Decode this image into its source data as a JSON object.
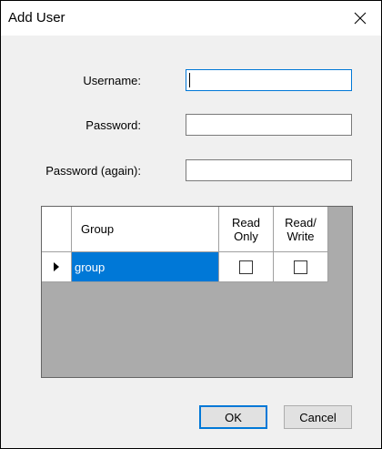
{
  "window": {
    "title": "Add User",
    "close_icon": "close-icon"
  },
  "form": {
    "username_label": "Username:",
    "username_value": "",
    "password_label": "Password:",
    "password_value": "",
    "password_again_label": "Password (again):",
    "password_again_value": ""
  },
  "grid": {
    "columns": [
      "",
      "Group",
      "Read Only",
      "Read/ Write"
    ],
    "rows": [
      {
        "group": "group",
        "read_only": false,
        "read_write": false,
        "selected": true
      }
    ]
  },
  "buttons": {
    "ok_label": "OK",
    "cancel_label": "Cancel"
  },
  "colors": {
    "selection": "#0078d7",
    "grid_background": "#ababab",
    "dialog_background": "#f0f0f0"
  }
}
